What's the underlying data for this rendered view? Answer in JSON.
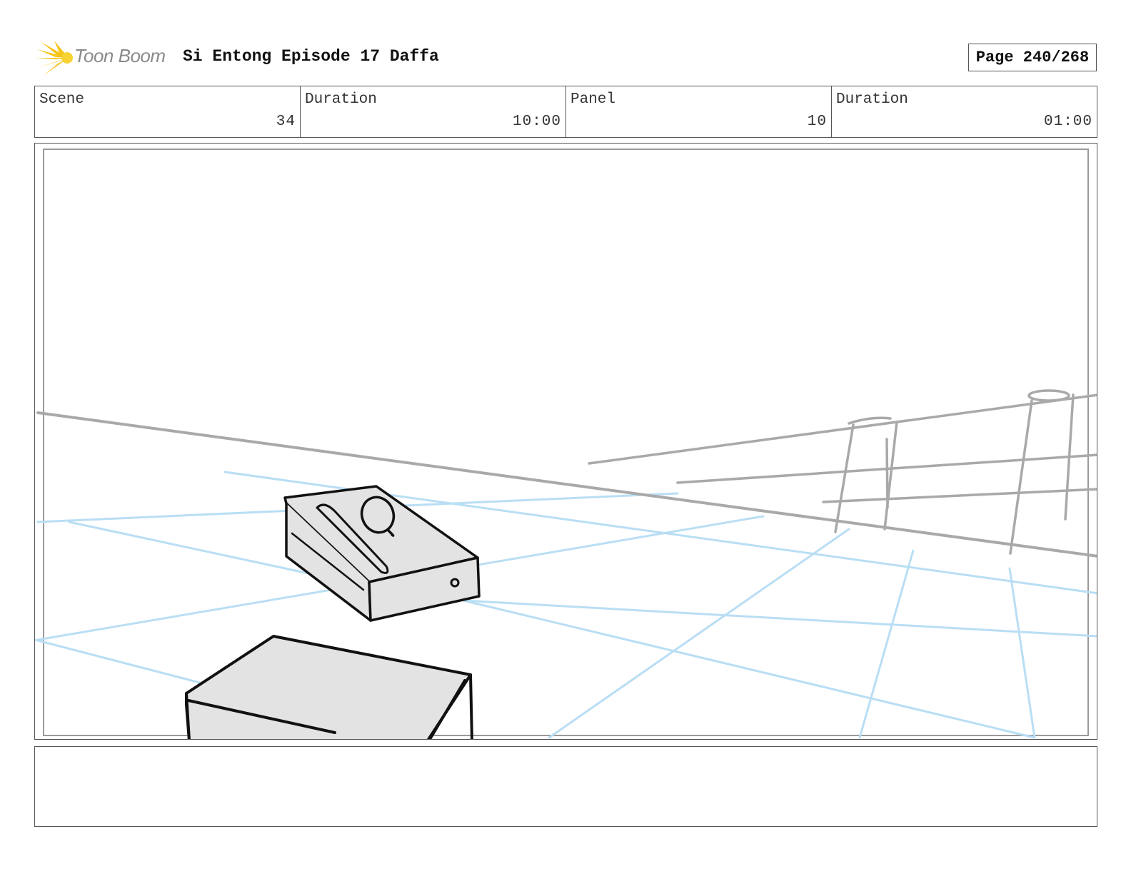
{
  "header": {
    "logo_text": "Toon Boom",
    "title": "Si Entong Episode 17 Daffa",
    "page": "Page 240/268"
  },
  "info": {
    "scene_label": "Scene",
    "scene_value": "34",
    "scene_duration_label": "Duration",
    "scene_duration_value": "10:00",
    "panel_label": "Panel",
    "panel_value": "10",
    "panel_duration_label": "Duration",
    "panel_duration_value": "01:00"
  },
  "panel": {
    "sketch_colors": {
      "ink": "#111111",
      "fill": "#e3e3e3",
      "guide_gray": "#a9a9a9",
      "perspective_blue": "#b9def4"
    },
    "objects": [
      "box-with-comb-and-mirror",
      "table",
      "fence",
      "floor-grid",
      "horizon-line"
    ]
  },
  "notes": {
    "text": ""
  }
}
